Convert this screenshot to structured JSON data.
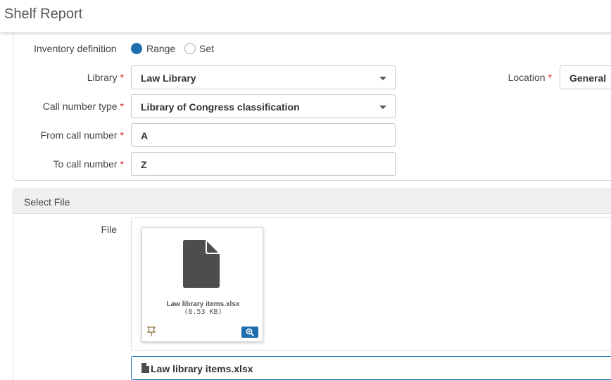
{
  "header": {
    "title": "Shelf Report"
  },
  "inventory": {
    "label": "Inventory definition",
    "options": [
      {
        "label": "Range",
        "selected": true
      },
      {
        "label": "Set",
        "selected": false
      }
    ]
  },
  "fields": {
    "library": {
      "label": "Library",
      "value": "Law Library"
    },
    "location": {
      "label": "Location",
      "value": "General"
    },
    "call_number_type": {
      "label": "Call number type",
      "value": "Library of Congress classification"
    },
    "from_call_number": {
      "label": "From call number",
      "value": "A"
    },
    "to_call_number": {
      "label": "To call number",
      "value": "Z"
    },
    "required_marker": "*"
  },
  "select_file": {
    "title": "Select File",
    "file_label": "File",
    "file": {
      "name": "Law library items.xlsx",
      "size": "(8.53 KB)"
    },
    "selected_file_name": "Law library items.xlsx"
  },
  "colors": {
    "accent": "#1f6fae",
    "required": "#d9232e",
    "doc_icon": "#4d4d4d"
  },
  "icons": [
    "document-icon",
    "pin-icon",
    "zoom-in-icon",
    "file-icon",
    "chevron-down-icon"
  ]
}
